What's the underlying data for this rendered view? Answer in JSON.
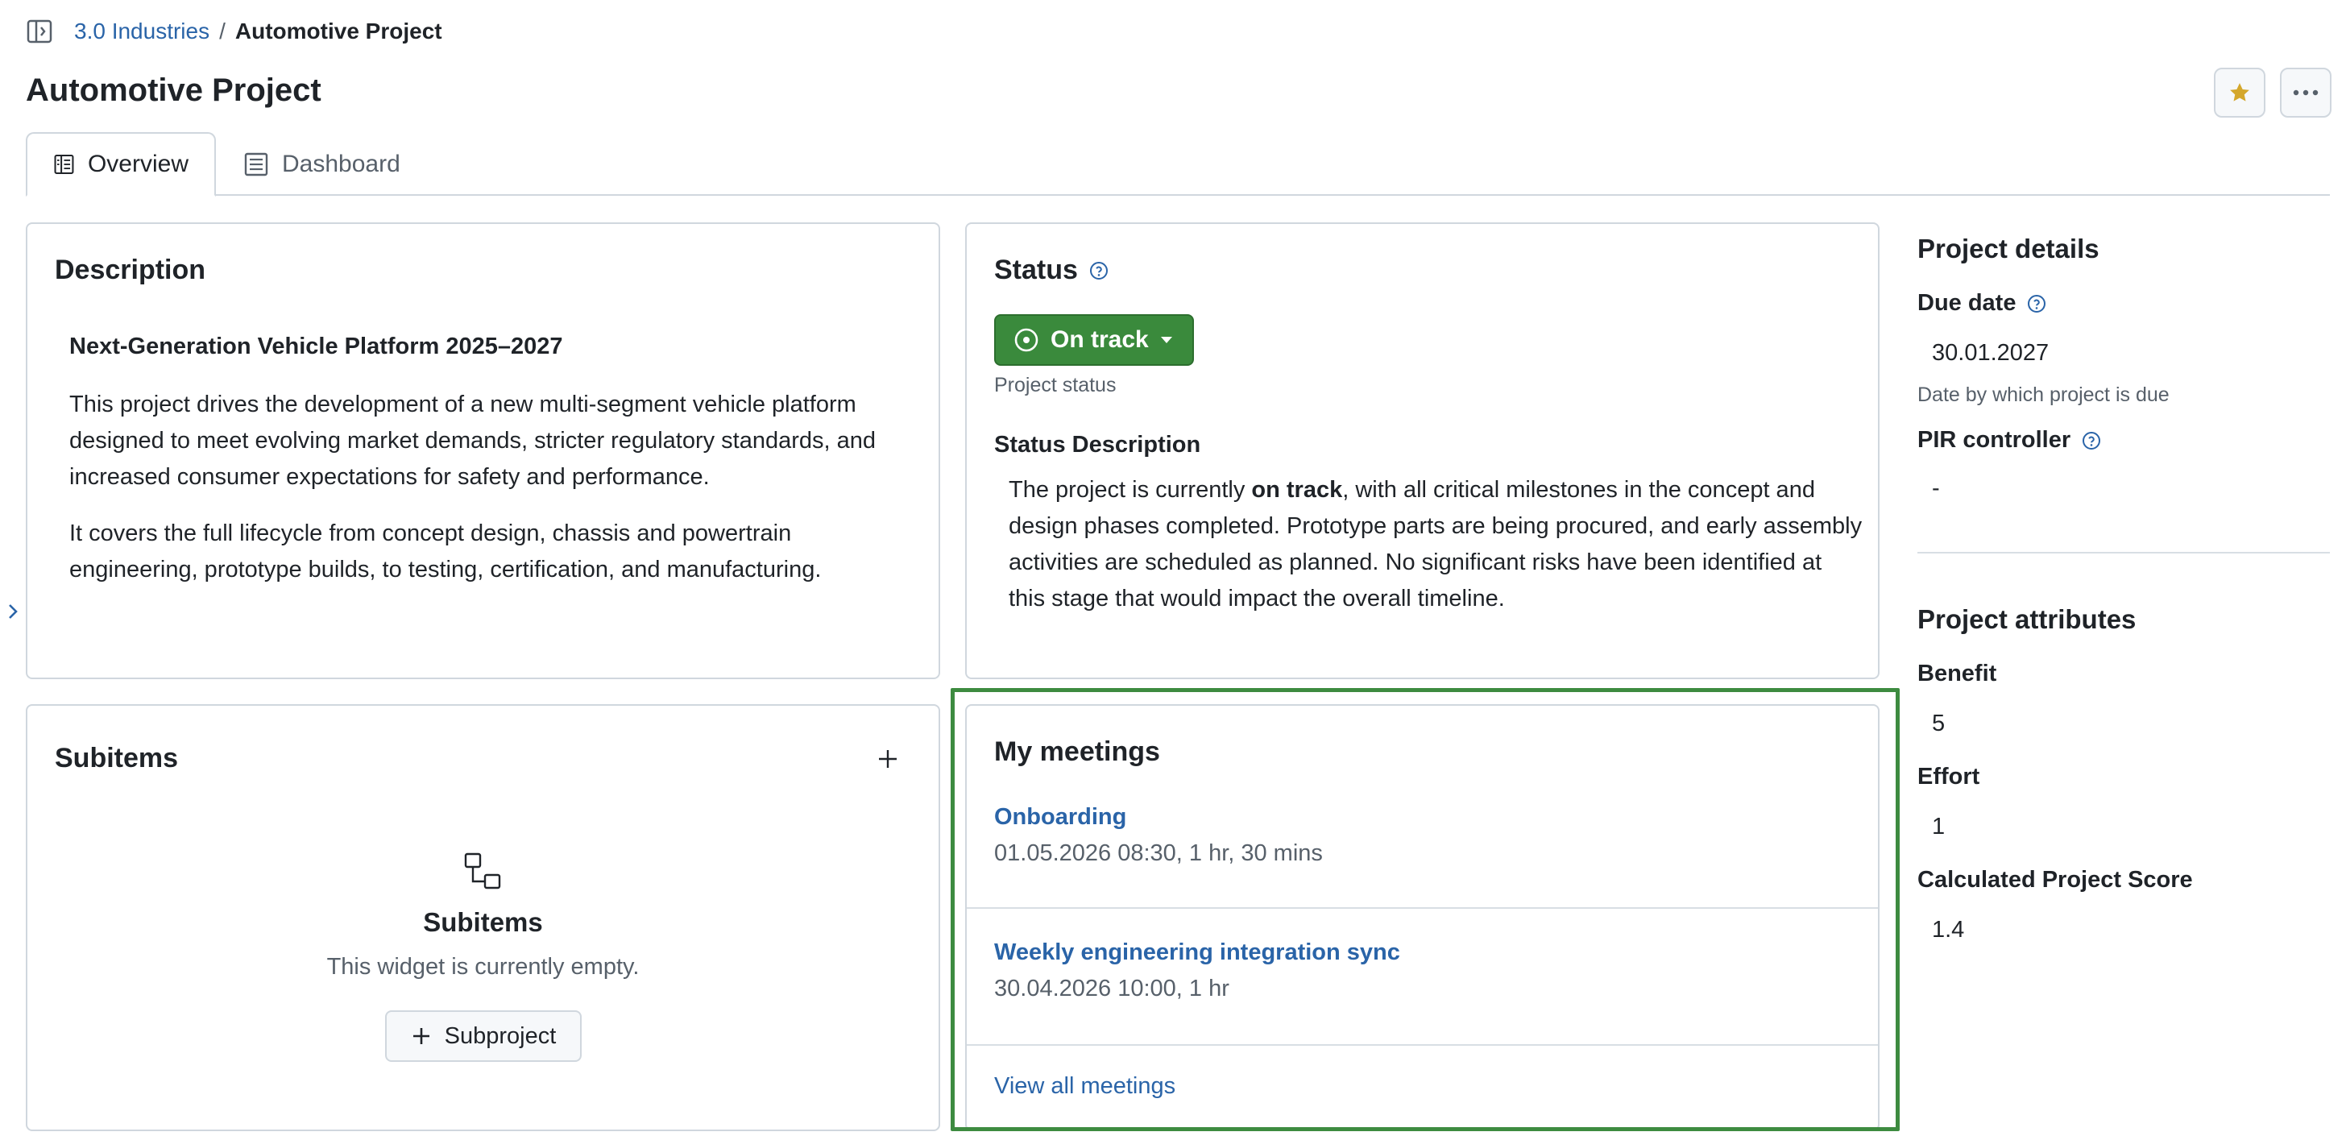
{
  "breadcrumb": {
    "parent": "3.0 Industries",
    "separator": "/",
    "current": "Automotive Project"
  },
  "page": {
    "title": "Automotive Project"
  },
  "tabs": [
    {
      "label": "Overview",
      "icon": "overview-icon",
      "active": true
    },
    {
      "label": "Dashboard",
      "icon": "dashboard-icon",
      "active": false
    }
  ],
  "description": {
    "title": "Description",
    "heading": "Next-Generation Vehicle Platform 2025–2027",
    "paragraphs": [
      "This project drives the development of a new multi-segment vehicle platform designed to meet evolving market demands, stricter regulatory standards, and increased consumer expectations for safety and performance.",
      "It covers the full lifecycle from concept design, chassis and powertrain engineering, prototype builds, to testing, certification, and manufacturing."
    ]
  },
  "status": {
    "title": "Status",
    "value": "On track",
    "caption": "Project status",
    "description_label": "Status Description",
    "description_pre": "The project is currently ",
    "description_bold": "on track",
    "description_post": ", with all critical milestones in the concept and design phases completed. Prototype parts are being procured, and early assembly activities are scheduled as planned. No significant risks have been identified at this stage that would impact the overall timeline.",
    "color": "#3a8a3c"
  },
  "subitems": {
    "title": "Subitems",
    "empty_title": "Subitems",
    "empty_text": "This widget is currently empty.",
    "add_button": "Subproject"
  },
  "meetings": {
    "title": "My meetings",
    "items": [
      {
        "name": "Onboarding",
        "time": "01.05.2026 08:30, 1 hr, 30 mins"
      },
      {
        "name": "Weekly engineering integration sync",
        "time": "30.04.2026 10:00, 1 hr"
      }
    ],
    "view_all": "View all meetings",
    "highlight_color": "#3d8b40"
  },
  "project_details": {
    "title": "Project details",
    "due_date_label": "Due date",
    "due_date_value": "30.01.2027",
    "due_date_caption": "Date by which project is due",
    "pir_label": "PIR controller",
    "pir_value": "-"
  },
  "project_attributes": {
    "title": "Project attributes",
    "items": [
      {
        "label": "Benefit",
        "value": "5"
      },
      {
        "label": "Effort",
        "value": "1"
      },
      {
        "label": "Calculated Project Score",
        "value": "1.4"
      }
    ]
  },
  "colors": {
    "link": "#2a64a8",
    "star": "#d4a72c",
    "border": "#d0d7de"
  }
}
